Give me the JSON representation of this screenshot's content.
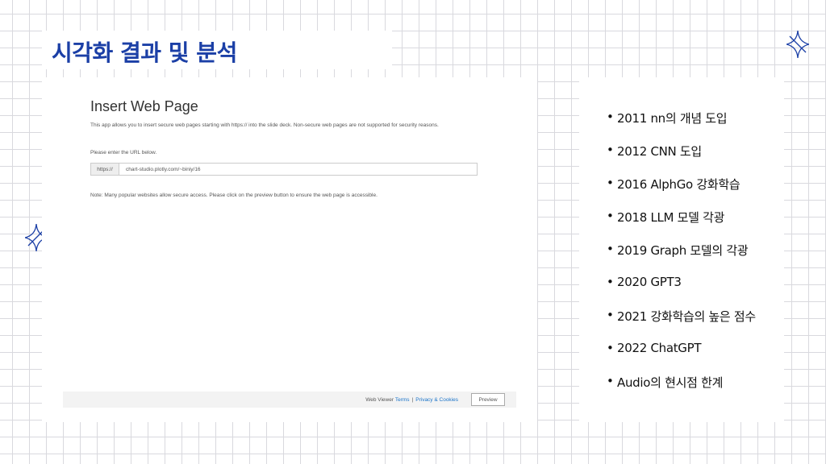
{
  "slide": {
    "title": "시각화 결과 및 분석",
    "accent_color": "#1b3fa6",
    "decorations": [
      "sparkle-star-icon",
      "sparkle-star-icon"
    ]
  },
  "web_page": {
    "heading": "Insert Web Page",
    "description": "This app allows you to insert secure web pages starting with https:// into the slide deck. Non-secure web pages are not supported for security reasons.",
    "prompt": "Please enter the URL below.",
    "url_prefix": "https://",
    "url_value": "chart-studio.plotly.com/~biniy/16",
    "note": "Note: Many popular websites allow secure access. Please click on the preview button to ensure the web page is accessible.",
    "footer": {
      "label": "Web Viewer",
      "terms": "Terms",
      "separator": "|",
      "privacy": "Privacy & Cookies",
      "preview_button": "Preview"
    }
  },
  "timeline": {
    "items": [
      "2011 nn의 개념 도입",
      "2012 CNN 도입",
      "2016 AlphGo 강화학습",
      "2018 LLM 모델 각광",
      "2019 Graph 모델의 각광",
      "2020 GPT3",
      "2021 강화학습의 높은 점수",
      "2022 ChatGPT",
      "Audio의 현시점 한계"
    ]
  }
}
